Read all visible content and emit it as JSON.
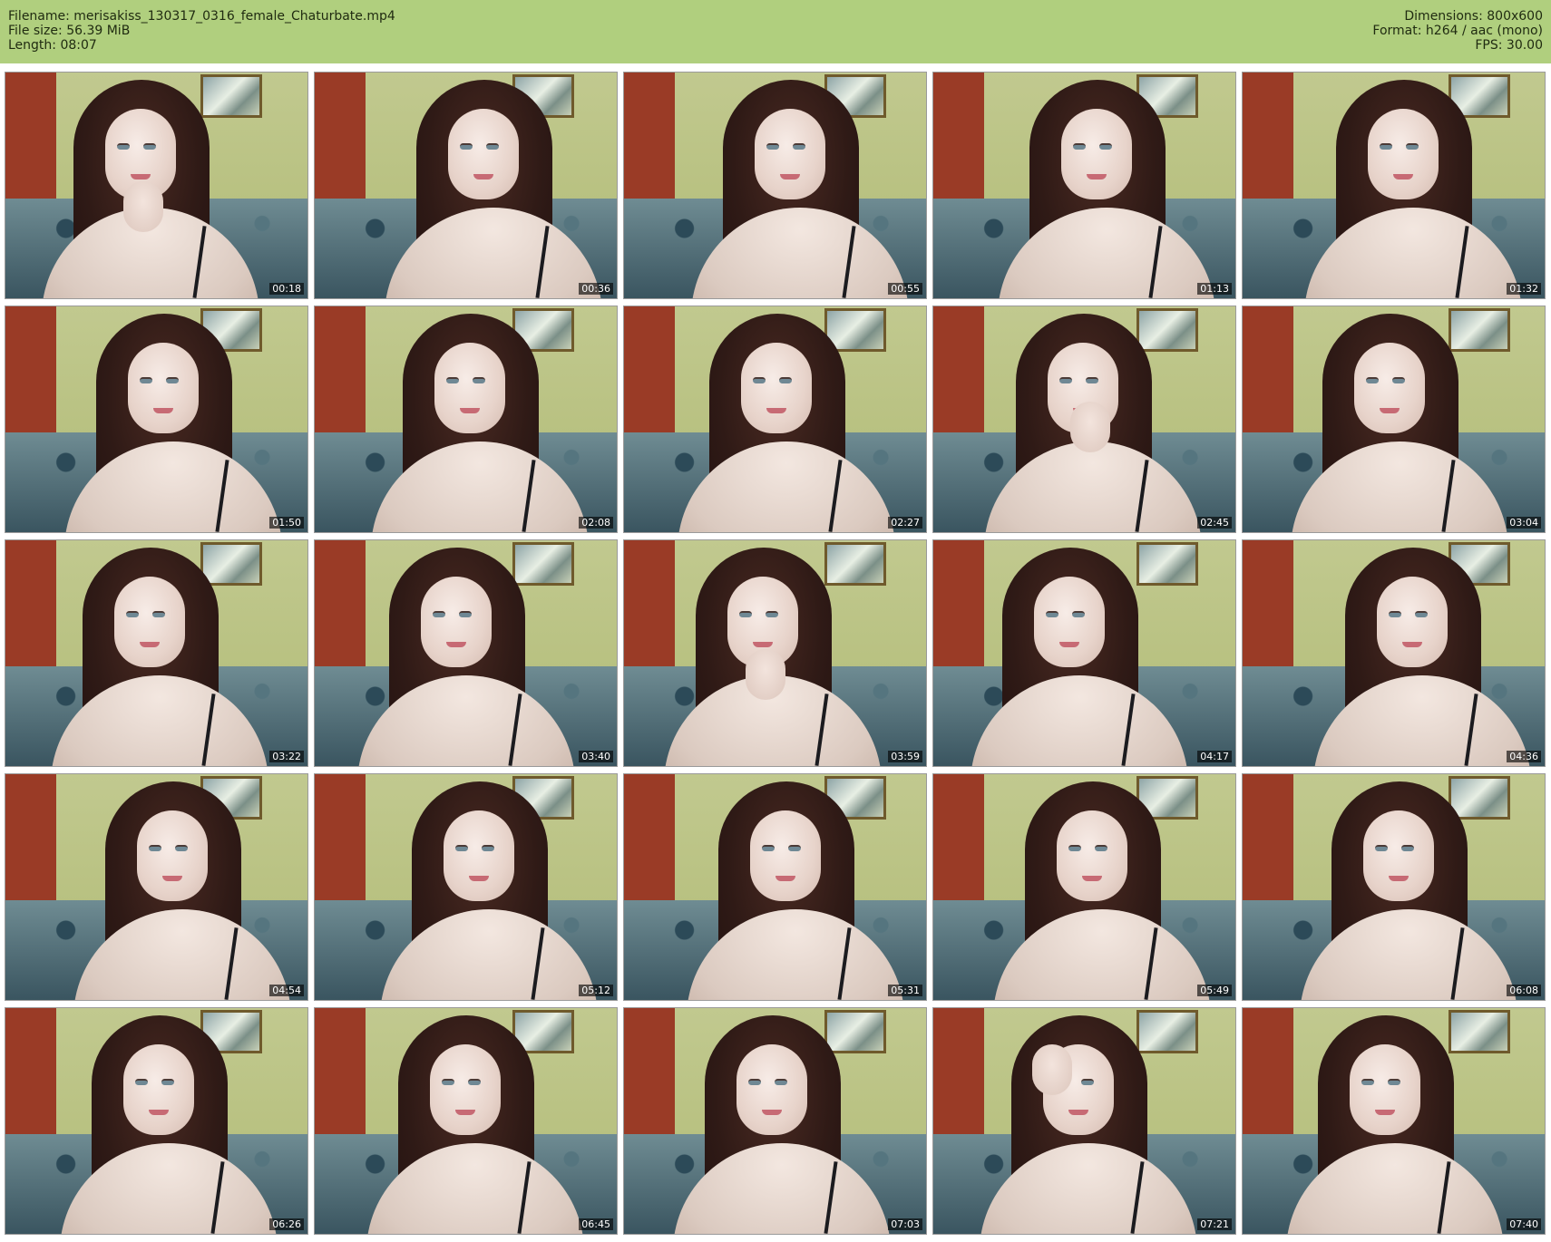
{
  "header": {
    "filename": "Filename: merisakiss_130317_0316_female_Chaturbate.mp4",
    "filesize": "File size: 56.39 MiB",
    "length": "Length: 08:07",
    "dimensions": "Dimensions: 800x600",
    "format": "Format: h264 / aac (mono)",
    "fps": "FPS: 30.00"
  },
  "colors": {
    "header_bg": "#b0cf7e"
  },
  "thumbnails": [
    {
      "timestamp": "00:18",
      "hand": "chin"
    },
    {
      "timestamp": "00:36"
    },
    {
      "timestamp": "00:55"
    },
    {
      "timestamp": "01:13"
    },
    {
      "timestamp": "01:32"
    },
    {
      "timestamp": "01:50"
    },
    {
      "timestamp": "02:08"
    },
    {
      "timestamp": "02:27"
    },
    {
      "timestamp": "02:45",
      "hand": "mouth"
    },
    {
      "timestamp": "03:04"
    },
    {
      "timestamp": "03:22"
    },
    {
      "timestamp": "03:40"
    },
    {
      "timestamp": "03:59",
      "hand": "chin"
    },
    {
      "timestamp": "04:17"
    },
    {
      "timestamp": "04:36"
    },
    {
      "timestamp": "04:54"
    },
    {
      "timestamp": "05:12"
    },
    {
      "timestamp": "05:31"
    },
    {
      "timestamp": "05:49"
    },
    {
      "timestamp": "06:08"
    },
    {
      "timestamp": "06:26"
    },
    {
      "timestamp": "06:45"
    },
    {
      "timestamp": "07:03"
    },
    {
      "timestamp": "07:21",
      "hand": "forehead"
    },
    {
      "timestamp": "07:40"
    }
  ]
}
